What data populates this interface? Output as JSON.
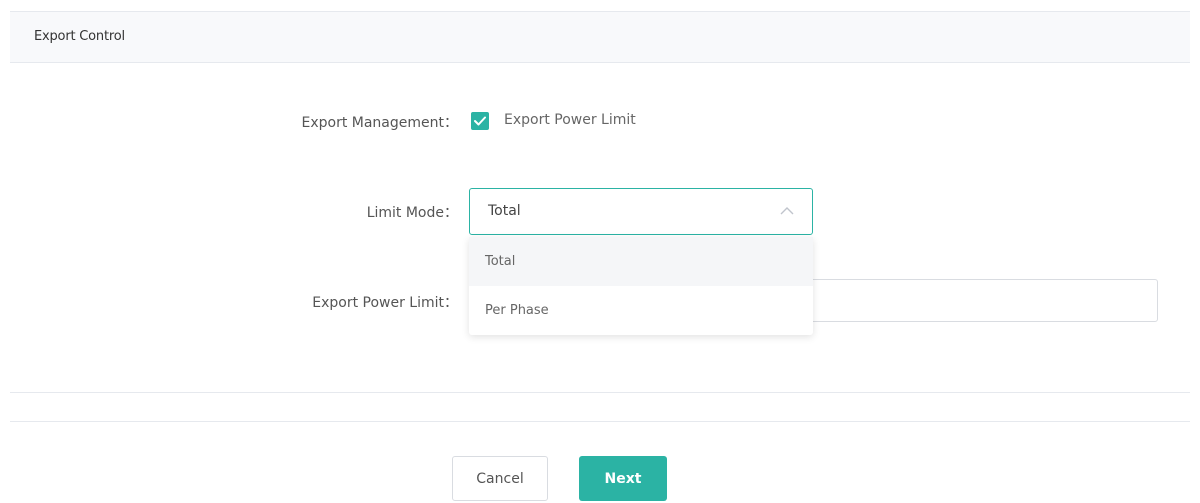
{
  "section": {
    "title": "Export Control"
  },
  "export_management": {
    "label": "Export Management：",
    "checkbox_checked": true,
    "checkbox_label": "Export Power Limit",
    "accent_color": "#2bb3a4"
  },
  "limit_mode": {
    "label": "Limit Mode：",
    "value": "Total",
    "dropdown_open": true,
    "options": [
      "Total",
      "Per Phase"
    ],
    "arrow_icon": "chevron-up-icon"
  },
  "export_power_limit": {
    "label": "Export Power Limit：",
    "value": ""
  },
  "buttons": {
    "cancel": "Cancel",
    "next": "Next"
  }
}
